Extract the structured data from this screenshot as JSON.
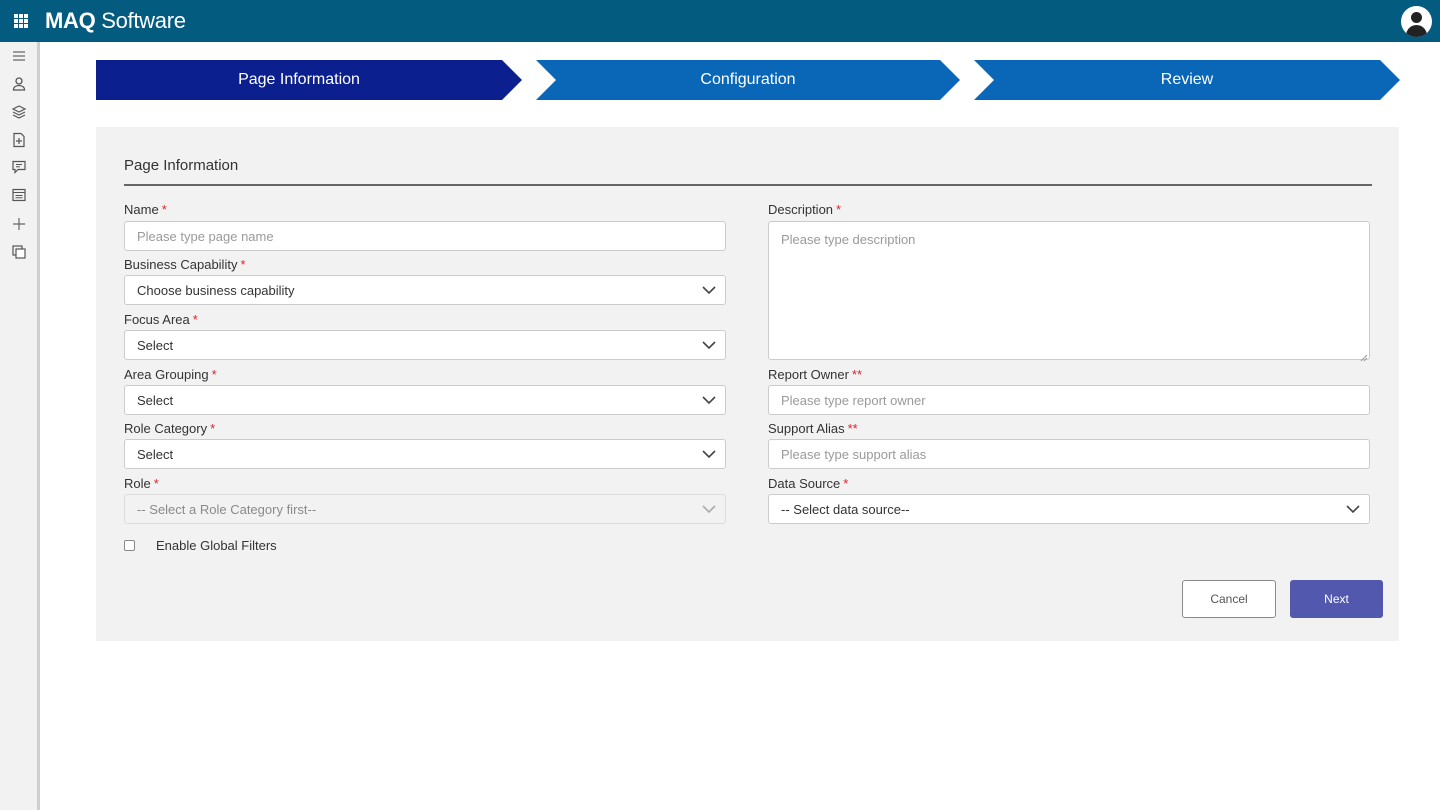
{
  "header": {
    "brand_bold": "MAQ",
    "brand_rest": " Software"
  },
  "rail_icons": [
    "menu-icon",
    "user-icon",
    "layers-icon",
    "add-page-icon",
    "comment-icon",
    "window-icon",
    "plus-icon",
    "copy-icon"
  ],
  "steps": [
    {
      "label": "Page Information",
      "state": "active"
    },
    {
      "label": "Configuration",
      "state": "pending"
    },
    {
      "label": "Review",
      "state": "pending"
    }
  ],
  "form": {
    "section_title": "Page Information",
    "name": {
      "label": "Name",
      "required": "*",
      "placeholder": "Please type page name"
    },
    "business_capability": {
      "label": "Business Capability",
      "required": "*",
      "value": "Choose business capability"
    },
    "focus_area": {
      "label": "Focus Area",
      "required": "*",
      "value": "Select"
    },
    "area_grouping": {
      "label": "Area Grouping",
      "required": "*",
      "value": "Select"
    },
    "role_category": {
      "label": "Role Category",
      "required": "*",
      "value": "Select"
    },
    "role": {
      "label": "Role",
      "required": "*",
      "value": "-- Select a Role Category first--"
    },
    "description": {
      "label": "Description",
      "required": "*",
      "placeholder": "Please type description"
    },
    "report_owner": {
      "label": "Report Owner",
      "required": "**",
      "placeholder": "Please type report owner"
    },
    "support_alias": {
      "label": "Support Alias",
      "required": "**",
      "placeholder": "Please type support alias"
    },
    "data_source": {
      "label": "Data Source",
      "required": "*",
      "value": "-- Select data source--"
    },
    "global_filters": {
      "label": "Enable Global Filters",
      "checked": false
    },
    "cancel_label": "Cancel",
    "next_label": "Next"
  },
  "colors": {
    "header_bg": "#045b80",
    "step_active": "#0b1f8f",
    "step_pending": "#0a67b8",
    "primary_button": "#5258ad",
    "required_marker": "#d9242c"
  }
}
